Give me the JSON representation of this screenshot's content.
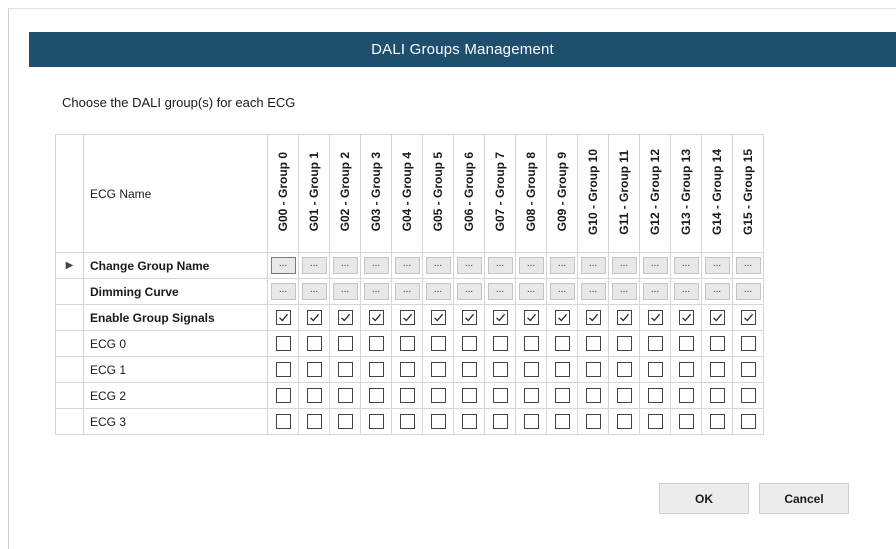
{
  "window": {
    "title": "DALI Groups Management"
  },
  "instruction": "Choose the DALI group(s) for each ECG",
  "table": {
    "name_header": "ECG Name",
    "groups": [
      "G00 - Group 0",
      "G01 - Group 1",
      "G02 - Group 2",
      "G03 - Group 3",
      "G04 - Group 4",
      "G05 - Group 5",
      "G06 - Group 6",
      "G07 - Group 7",
      "G08 - Group 8",
      "G09 - Group 9",
      "G10 - Group 10",
      "G11 - Group 11",
      "G12 - Group 12",
      "G13 - Group 13",
      "G14 - Group 14",
      "G15 - Group 15"
    ],
    "current_row_indicator": "▶",
    "button_rows": [
      {
        "label": "Change Group Name",
        "button_text": "...",
        "current": true
      },
      {
        "label": "Dimming Curve",
        "button_text": "...",
        "current": false
      }
    ],
    "enable_row": {
      "label": "Enable Group Signals",
      "checked": [
        true,
        true,
        true,
        true,
        true,
        true,
        true,
        true,
        true,
        true,
        true,
        true,
        true,
        true,
        true,
        true
      ]
    },
    "ecg_rows": [
      {
        "label": "ECG 0",
        "checked": [
          false,
          false,
          false,
          false,
          false,
          false,
          false,
          false,
          false,
          false,
          false,
          false,
          false,
          false,
          false,
          false
        ]
      },
      {
        "label": "ECG 1",
        "checked": [
          false,
          false,
          false,
          false,
          false,
          false,
          false,
          false,
          false,
          false,
          false,
          false,
          false,
          false,
          false,
          false
        ]
      },
      {
        "label": "ECG 2",
        "checked": [
          false,
          false,
          false,
          false,
          false,
          false,
          false,
          false,
          false,
          false,
          false,
          false,
          false,
          false,
          false,
          false
        ]
      },
      {
        "label": "ECG 3",
        "checked": [
          false,
          false,
          false,
          false,
          false,
          false,
          false,
          false,
          false,
          false,
          false,
          false,
          false,
          false,
          false,
          false
        ]
      }
    ]
  },
  "buttons": {
    "ok": "OK",
    "cancel": "Cancel"
  },
  "icons": {
    "row_indicator": "triangle-right-icon",
    "check": "checkmark-icon"
  },
  "colors": {
    "titlebar": "#1e4f6e",
    "titlebar_text": "#ffffff"
  }
}
